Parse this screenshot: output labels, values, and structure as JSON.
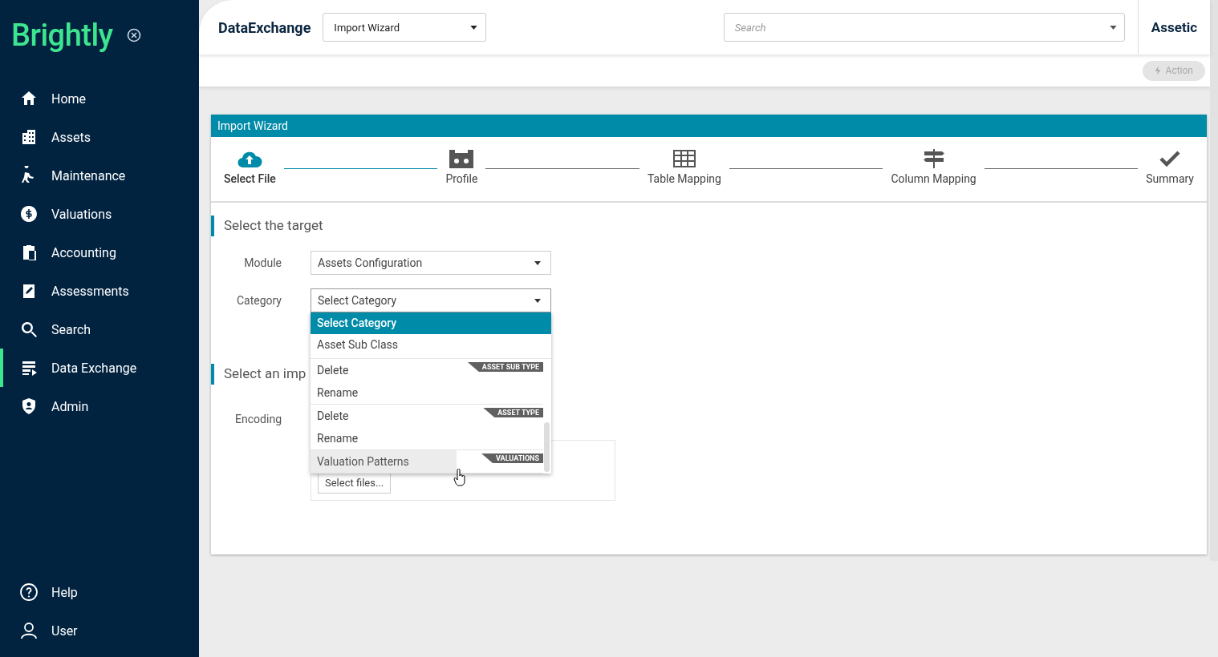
{
  "sidebar": {
    "logo": "Brightly",
    "items": [
      {
        "label": "Home",
        "selected": false
      },
      {
        "label": "Assets",
        "selected": false
      },
      {
        "label": "Maintenance",
        "selected": false
      },
      {
        "label": "Valuations",
        "selected": false
      },
      {
        "label": "Accounting",
        "selected": false
      },
      {
        "label": "Assessments",
        "selected": false
      },
      {
        "label": "Search",
        "selected": false
      },
      {
        "label": "Data Exchange",
        "selected": true
      },
      {
        "label": "Admin",
        "selected": false
      }
    ],
    "bottom_items": [
      {
        "label": "Help"
      },
      {
        "label": "User"
      }
    ]
  },
  "header": {
    "app_title": "DataExchange",
    "view_select": "Import Wizard",
    "search": {
      "placeholder": "Search"
    },
    "brand": "Assetic"
  },
  "action_button": {
    "label": "Action",
    "disabled": true
  },
  "wizard": {
    "title": "Import Wizard",
    "steps": [
      {
        "label": "Select File",
        "selected": true
      },
      {
        "label": "Profile",
        "selected": false
      },
      {
        "label": "Table Mapping",
        "selected": false
      },
      {
        "label": "Column Mapping",
        "selected": false
      },
      {
        "label": "Summary",
        "selected": false
      }
    ],
    "section_target": "Select the target",
    "module": {
      "label": "Module",
      "value": "Assets Configuration"
    },
    "category": {
      "label": "Category",
      "value": "Select Category"
    },
    "section_import": "Select an imp",
    "encoding": {
      "label": "Encoding"
    },
    "select_files": "Select files...",
    "dropdown": {
      "options": [
        {
          "label": "Select Category",
          "selected": true
        },
        {
          "label": "Asset Sub Class",
          "selected": false
        }
      ],
      "groups": [
        {
          "tag": "ASSET SUB TYPE",
          "items": [
            {
              "label": "Delete",
              "hovered": false
            },
            {
              "label": "Rename",
              "hovered": false
            }
          ]
        },
        {
          "tag": "ASSET TYPE",
          "items": [
            {
              "label": "Delete",
              "hovered": false
            },
            {
              "label": "Rename",
              "hovered": false
            }
          ]
        },
        {
          "tag": "VALUATIONS",
          "items": [
            {
              "label": "Valuation Patterns",
              "hovered": true
            }
          ]
        }
      ]
    }
  }
}
